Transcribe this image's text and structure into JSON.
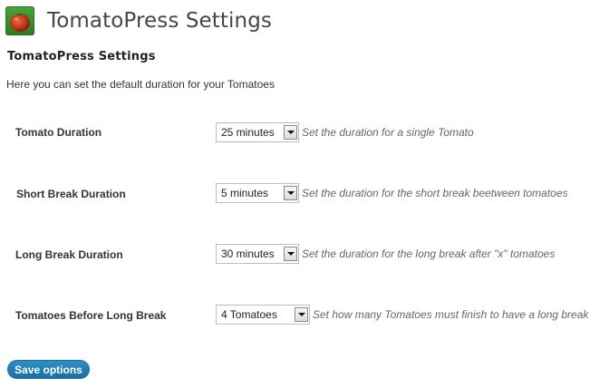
{
  "header": {
    "icon": "tomato-icon",
    "title": "TomatoPress Settings"
  },
  "section": {
    "title": "TomatoPress Settings",
    "intro": "Here you can set the default duration for your Tomatoes"
  },
  "fields": [
    {
      "label": "Tomato Duration",
      "selected": "25 minutes",
      "help": "Set the duration for a single Tomato"
    },
    {
      "label": "Short Break Duration",
      "selected": "5 minutes",
      "help": "Set the duration for the short break beetween tomatoes"
    },
    {
      "label": "Long Break Duration",
      "selected": "30 minutes",
      "help": "Set the duration for the long break after \"x\" tomatoes"
    },
    {
      "label": "Tomatoes Before Long Break",
      "selected": "4 Tomatoes",
      "help": "Set how many Tomatoes must finish to have a long break"
    }
  ],
  "actions": {
    "save_label": "Save options"
  },
  "colors": {
    "accent": "#21759b",
    "icon_background": "#3a8f2e",
    "tomato": "#c43a1e"
  }
}
